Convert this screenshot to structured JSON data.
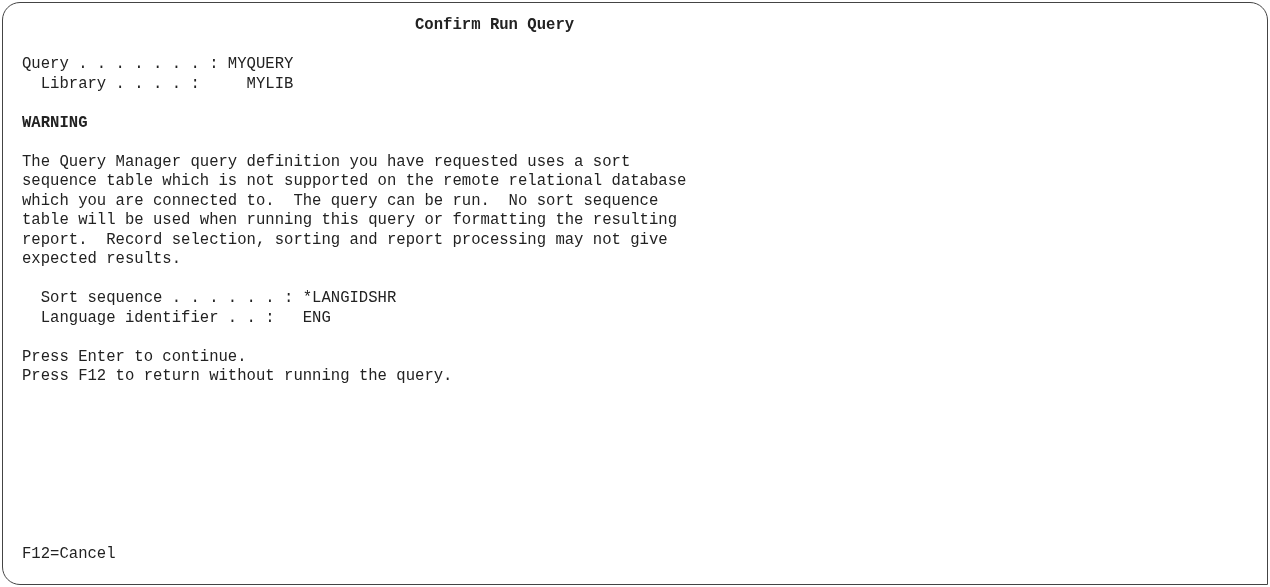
{
  "title": "Confirm Run Query",
  "query_fields": [
    {
      "label": "Query . . . . . . . :",
      "value": "MYQUERY",
      "indented": false
    },
    {
      "label": "Library . . . . :",
      "value": "MYLIB",
      "indented": true
    }
  ],
  "warning_heading": "WARNING",
  "warning_text": "The Query Manager query definition you have requested uses a sort\nsequence table which is not supported on the remote relational database\nwhich you are connected to.  The query can be run.  No sort sequence\ntable will be used when running this query or formatting the resulting\nreport.  Record selection, sorting and report processing may not give\nexpected results.",
  "sort_fields": [
    {
      "label": "Sort sequence . . . . . . :",
      "value": "*LANGIDSHR",
      "indented": true
    },
    {
      "label": "Language identifier . . :",
      "value": "ENG",
      "indented": true
    }
  ],
  "instructions": [
    "Press Enter to continue.",
    "Press F12 to return without running the query."
  ],
  "function_keys": [
    "F12=Cancel"
  ]
}
